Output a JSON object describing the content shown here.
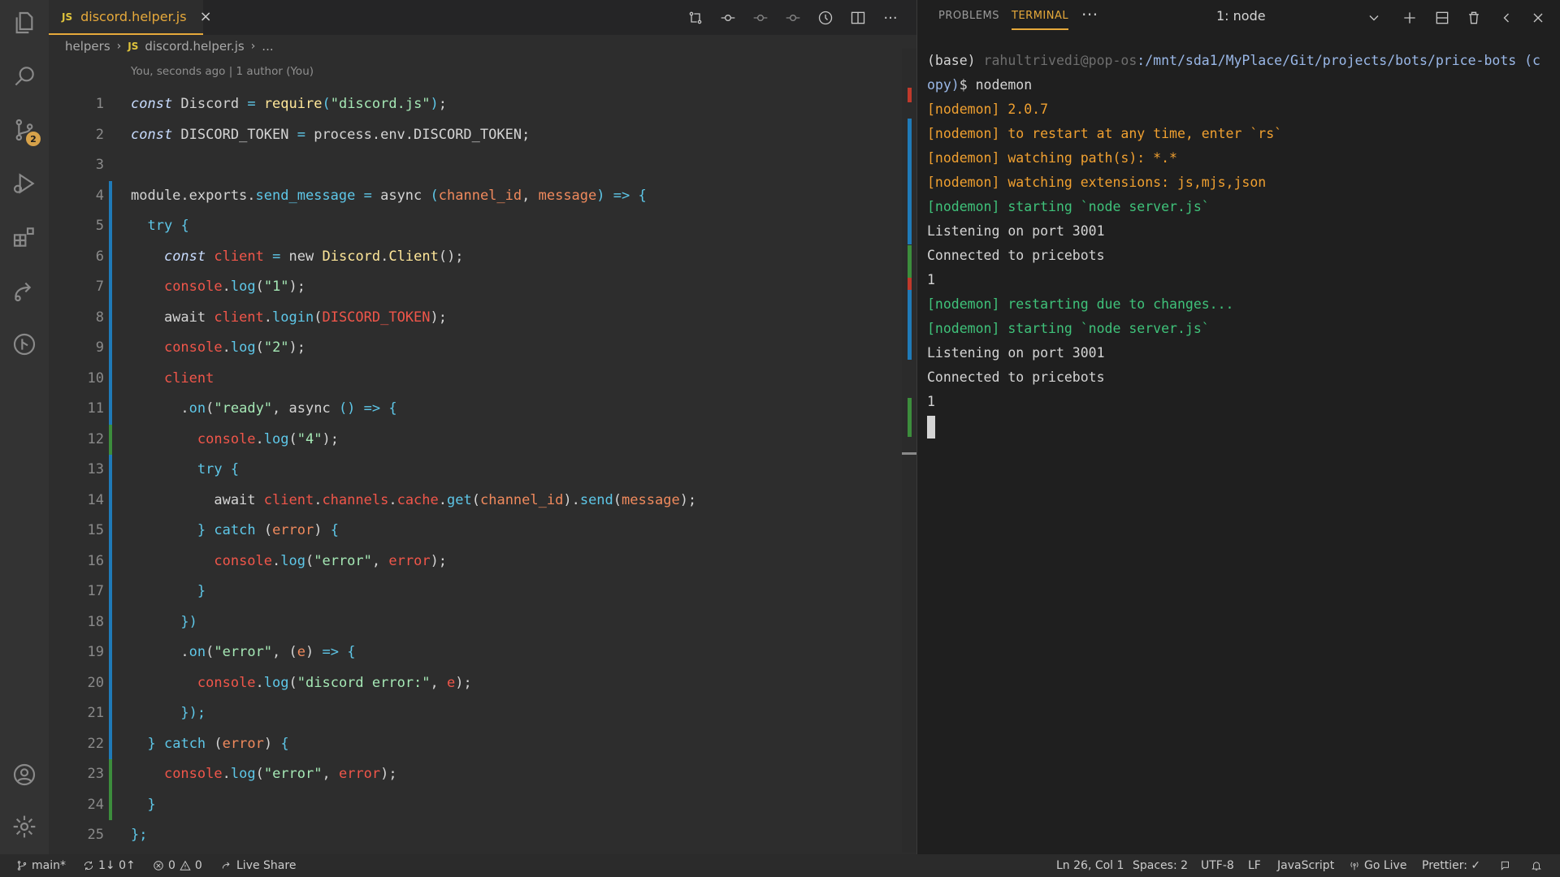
{
  "editor": {
    "tab": {
      "icon_label": "JS",
      "title": "discord.helper.js",
      "close_glyph": "×"
    },
    "breadcrumb": {
      "folder": "helpers",
      "sep": "›",
      "file_icon_label": "JS",
      "file": "discord.helper.js",
      "ellipsis": "..."
    },
    "codelens": "You, seconds ago | 1 author (You)",
    "more_glyph": "···",
    "lines": [
      {
        "n": "1",
        "tokens": [
          [
            "kw",
            "const"
          ],
          [
            "plain",
            " Discord "
          ],
          [
            "op",
            "="
          ],
          [
            "plain",
            " "
          ],
          [
            "fn",
            "require"
          ],
          [
            "punc",
            "("
          ],
          [
            "str",
            "\"discord.js\""
          ],
          [
            "punc",
            ")"
          ],
          [
            "plain",
            ";"
          ]
        ]
      },
      {
        "n": "2",
        "tokens": [
          [
            "kw",
            "const"
          ],
          [
            "plain",
            " DISCORD_TOKEN "
          ],
          [
            "op",
            "="
          ],
          [
            "plain",
            " process.env.DISCORD_TOKEN"
          ],
          [
            "plain",
            ";"
          ]
        ]
      },
      {
        "n": "3",
        "tokens": []
      },
      {
        "n": "4",
        "tokens": [
          [
            "plain",
            "module.exports."
          ],
          [
            "prop",
            "send_message"
          ],
          [
            "plain",
            " "
          ],
          [
            "op",
            "="
          ],
          [
            "plain",
            " async "
          ],
          [
            "punc",
            "("
          ],
          [
            "par",
            "channel_id"
          ],
          [
            "plain",
            ", "
          ],
          [
            "par",
            "message"
          ],
          [
            "punc",
            ")"
          ],
          [
            "plain",
            " "
          ],
          [
            "op",
            "=>"
          ],
          [
            "plain",
            " "
          ],
          [
            "punc",
            "{"
          ]
        ]
      },
      {
        "n": "5",
        "tokens": [
          [
            "plain",
            "  "
          ],
          [
            "prop",
            "try"
          ],
          [
            "plain",
            " "
          ],
          [
            "punc",
            "{"
          ]
        ]
      },
      {
        "n": "6",
        "tokens": [
          [
            "plain",
            "    "
          ],
          [
            "kw",
            "const"
          ],
          [
            "plain",
            " "
          ],
          [
            "var",
            "client"
          ],
          [
            "plain",
            " "
          ],
          [
            "op",
            "="
          ],
          [
            "plain",
            " new "
          ],
          [
            "fn",
            "Discord"
          ],
          [
            "plain",
            "."
          ],
          [
            "fn",
            "Client"
          ],
          [
            "plain",
            "();"
          ]
        ]
      },
      {
        "n": "7",
        "tokens": [
          [
            "plain",
            "    "
          ],
          [
            "var",
            "console"
          ],
          [
            "plain",
            "."
          ],
          [
            "prop",
            "log"
          ],
          [
            "plain",
            "("
          ],
          [
            "str",
            "\"1\""
          ],
          [
            "plain",
            ");"
          ]
        ]
      },
      {
        "n": "8",
        "tokens": [
          [
            "plain",
            "    await "
          ],
          [
            "var",
            "client"
          ],
          [
            "plain",
            "."
          ],
          [
            "prop",
            "login"
          ],
          [
            "plain",
            "("
          ],
          [
            "var",
            "DISCORD_TOKEN"
          ],
          [
            "plain",
            ");"
          ]
        ]
      },
      {
        "n": "9",
        "tokens": [
          [
            "plain",
            "    "
          ],
          [
            "var",
            "console"
          ],
          [
            "plain",
            "."
          ],
          [
            "prop",
            "log"
          ],
          [
            "plain",
            "("
          ],
          [
            "str",
            "\"2\""
          ],
          [
            "plain",
            ");"
          ]
        ]
      },
      {
        "n": "10",
        "tokens": [
          [
            "plain",
            "    "
          ],
          [
            "var",
            "client"
          ]
        ]
      },
      {
        "n": "11",
        "tokens": [
          [
            "plain",
            "      ."
          ],
          [
            "prop",
            "on"
          ],
          [
            "plain",
            "("
          ],
          [
            "str",
            "\"ready\""
          ],
          [
            "plain",
            ", async "
          ],
          [
            "punc",
            "()"
          ],
          [
            "plain",
            " "
          ],
          [
            "op",
            "=>"
          ],
          [
            "plain",
            " "
          ],
          [
            "punc",
            "{"
          ]
        ]
      },
      {
        "n": "12",
        "tokens": [
          [
            "plain",
            "        "
          ],
          [
            "var",
            "console"
          ],
          [
            "plain",
            "."
          ],
          [
            "prop",
            "log"
          ],
          [
            "plain",
            "("
          ],
          [
            "str",
            "\"4\""
          ],
          [
            "plain",
            ");"
          ]
        ]
      },
      {
        "n": "13",
        "tokens": [
          [
            "plain",
            "        "
          ],
          [
            "prop",
            "try"
          ],
          [
            "plain",
            " "
          ],
          [
            "punc",
            "{"
          ]
        ]
      },
      {
        "n": "14",
        "tokens": [
          [
            "plain",
            "          await "
          ],
          [
            "var",
            "client"
          ],
          [
            "plain",
            "."
          ],
          [
            "var",
            "channels"
          ],
          [
            "plain",
            "."
          ],
          [
            "var",
            "cache"
          ],
          [
            "plain",
            "."
          ],
          [
            "prop",
            "get"
          ],
          [
            "plain",
            "("
          ],
          [
            "par",
            "channel_id"
          ],
          [
            "plain",
            ")."
          ],
          [
            "prop",
            "send"
          ],
          [
            "plain",
            "("
          ],
          [
            "par",
            "message"
          ],
          [
            "plain",
            ");"
          ]
        ]
      },
      {
        "n": "15",
        "tokens": [
          [
            "plain",
            "        "
          ],
          [
            "punc",
            "}"
          ],
          [
            "plain",
            " "
          ],
          [
            "prop",
            "catch"
          ],
          [
            "plain",
            " ("
          ],
          [
            "par",
            "error"
          ],
          [
            "plain",
            ") "
          ],
          [
            "punc",
            "{"
          ]
        ]
      },
      {
        "n": "16",
        "tokens": [
          [
            "plain",
            "          "
          ],
          [
            "var",
            "console"
          ],
          [
            "plain",
            "."
          ],
          [
            "prop",
            "log"
          ],
          [
            "plain",
            "("
          ],
          [
            "str",
            "\"error\""
          ],
          [
            "plain",
            ", "
          ],
          [
            "var",
            "error"
          ],
          [
            "plain",
            ");"
          ]
        ]
      },
      {
        "n": "17",
        "tokens": [
          [
            "plain",
            "        "
          ],
          [
            "punc",
            "}"
          ]
        ]
      },
      {
        "n": "18",
        "tokens": [
          [
            "plain",
            "      "
          ],
          [
            "punc",
            "})"
          ]
        ]
      },
      {
        "n": "19",
        "tokens": [
          [
            "plain",
            "      ."
          ],
          [
            "prop",
            "on"
          ],
          [
            "plain",
            "("
          ],
          [
            "str",
            "\"error\""
          ],
          [
            "plain",
            ", ("
          ],
          [
            "par",
            "e"
          ],
          [
            "plain",
            ") "
          ],
          [
            "op",
            "=>"
          ],
          [
            "plain",
            " "
          ],
          [
            "punc",
            "{"
          ]
        ]
      },
      {
        "n": "20",
        "tokens": [
          [
            "plain",
            "        "
          ],
          [
            "var",
            "console"
          ],
          [
            "plain",
            "."
          ],
          [
            "prop",
            "log"
          ],
          [
            "plain",
            "("
          ],
          [
            "str",
            "\"discord error:\""
          ],
          [
            "plain",
            ", "
          ],
          [
            "var",
            "e"
          ],
          [
            "plain",
            ");"
          ]
        ]
      },
      {
        "n": "21",
        "tokens": [
          [
            "plain",
            "      "
          ],
          [
            "punc",
            "});"
          ]
        ]
      },
      {
        "n": "22",
        "tokens": [
          [
            "plain",
            "  "
          ],
          [
            "punc",
            "}"
          ],
          [
            "plain",
            " "
          ],
          [
            "prop",
            "catch"
          ],
          [
            "plain",
            " ("
          ],
          [
            "par",
            "error"
          ],
          [
            "plain",
            ") "
          ],
          [
            "punc",
            "{"
          ]
        ]
      },
      {
        "n": "23",
        "tokens": [
          [
            "plain",
            "    "
          ],
          [
            "var",
            "console"
          ],
          [
            "plain",
            "."
          ],
          [
            "prop",
            "log"
          ],
          [
            "plain",
            "("
          ],
          [
            "str",
            "\"error\""
          ],
          [
            "plain",
            ", "
          ],
          [
            "var",
            "error"
          ],
          [
            "plain",
            ");"
          ]
        ]
      },
      {
        "n": "24",
        "tokens": [
          [
            "plain",
            "  "
          ],
          [
            "punc",
            "}"
          ]
        ]
      },
      {
        "n": "25",
        "tokens": [
          [
            "punc",
            "};"
          ]
        ]
      }
    ]
  },
  "panel": {
    "tabs": {
      "problems": "PROBLEMS",
      "terminal": "TERMINAL",
      "more": "···"
    },
    "terminal_select": "1: node",
    "lines": [
      [
        [
          "t-plain",
          "(base) "
        ],
        [
          "t-user",
          "rahultrivedi@pop-os"
        ],
        [
          "t-path",
          ":/mnt/sda1/MyPlace/Git/projects/bots/price-bots (c"
        ]
      ],
      [
        [
          "t-path",
          "opy)"
        ],
        [
          "t-plain",
          "$ nodemon"
        ]
      ],
      [
        [
          "t-yellow",
          "[nodemon] 2.0.7"
        ]
      ],
      [
        [
          "t-yellow",
          "[nodemon] to restart at any time, enter `rs`"
        ]
      ],
      [
        [
          "t-yellow",
          "[nodemon] watching path(s): *.*"
        ]
      ],
      [
        [
          "t-yellow",
          "[nodemon] watching extensions: js,mjs,json"
        ]
      ],
      [
        [
          "t-green",
          "[nodemon] starting `node server.js`"
        ]
      ],
      [
        [
          "t-plain",
          "Listening on port 3001"
        ]
      ],
      [
        [
          "t-plain",
          "Connected to pricebots"
        ]
      ],
      [
        [
          "t-plain",
          "1"
        ]
      ],
      [
        [
          "t-green",
          "[nodemon] restarting due to changes..."
        ]
      ],
      [
        [
          "t-green",
          "[nodemon] starting `node server.js`"
        ]
      ],
      [
        [
          "t-plain",
          "Listening on port 3001"
        ]
      ],
      [
        [
          "t-plain",
          "Connected to pricebots"
        ]
      ],
      [
        [
          "t-plain",
          "1"
        ]
      ]
    ]
  },
  "activity_bar": {
    "scm_badge": "2",
    "icons": [
      "files-icon",
      "search-icon",
      "source-control-icon",
      "run-debug-icon",
      "extensions-icon",
      "live-share-icon",
      "git-graph-icon",
      "account-icon",
      "settings-icon"
    ]
  },
  "statusbar": {
    "branch": "main*",
    "sync": "1↓ 0↑",
    "errors": "0",
    "warnings": "0",
    "live_share": "Live Share",
    "cursor_pos": "Ln 26, Col 1",
    "spaces": "Spaces: 2",
    "encoding": "UTF-8",
    "eol": "LF",
    "language": "JavaScript",
    "go_live": "Go Live",
    "prettier": "Prettier: ✓"
  },
  "colors": {
    "accent": "#e6a93b",
    "background": "#2b2b2b",
    "terminal_green": "#3fc27a",
    "terminal_yellow": "#f0a030"
  }
}
